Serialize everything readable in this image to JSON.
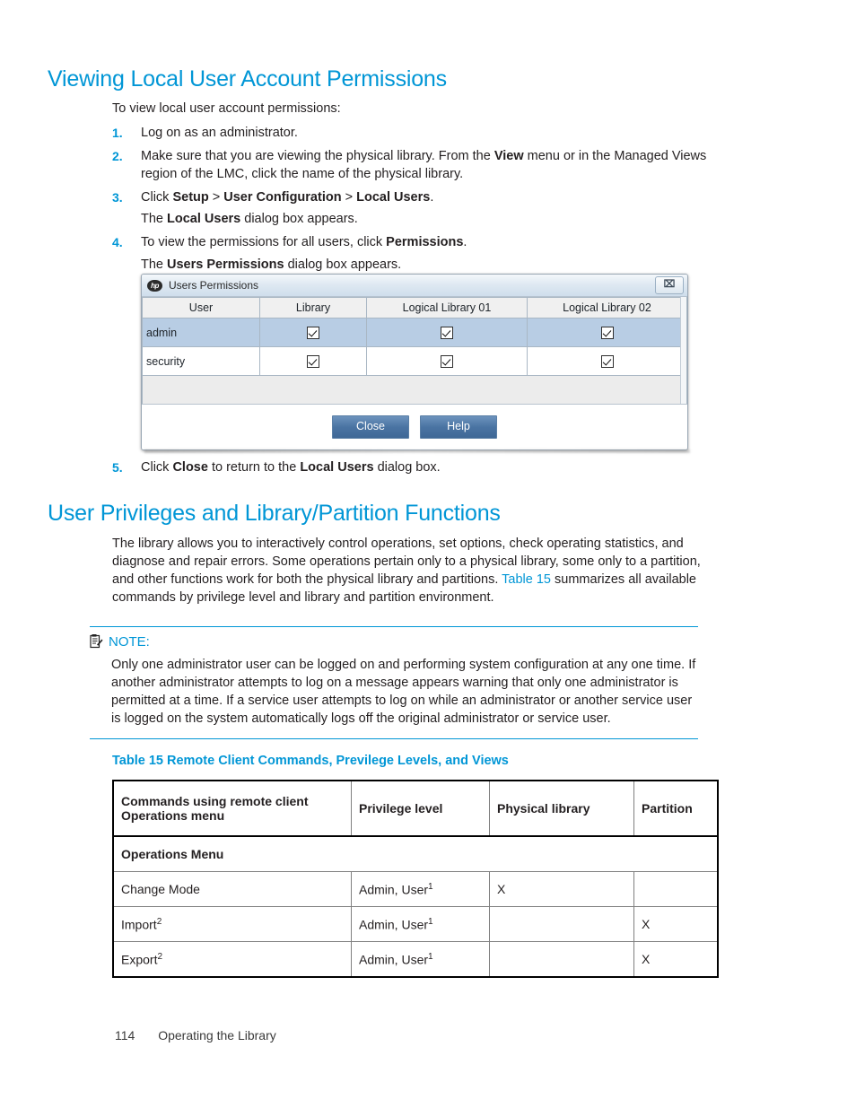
{
  "headings": {
    "viewing": "Viewing Local User Account Permissions",
    "privileges": "User Privileges and Library/Partition Functions"
  },
  "intro": "To view local user account permissions:",
  "steps": [
    {
      "num": "1.",
      "parts": [
        {
          "t": "Log on as an administrator.",
          "b": false
        }
      ]
    },
    {
      "num": "2.",
      "parts": [
        {
          "t": "Make sure that you are viewing the physical library. From the ",
          "b": false
        },
        {
          "t": "View",
          "b": true
        },
        {
          "t": " menu or in the Managed Views region of the LMC, click the name of the physical library.",
          "b": false
        }
      ]
    },
    {
      "num": "3.",
      "parts": [
        {
          "t": "Click ",
          "b": false
        },
        {
          "t": "Setup",
          "b": true
        },
        {
          "t": " > ",
          "b": false
        },
        {
          "t": "User Configuration",
          "b": true
        },
        {
          "t": " > ",
          "b": false
        },
        {
          "t": "Local Users",
          "b": true
        },
        {
          "t": ".",
          "b": false
        }
      ],
      "sub": [
        {
          "t": "The ",
          "b": false
        },
        {
          "t": "Local Users",
          "b": true
        },
        {
          "t": " dialog box appears.",
          "b": false
        }
      ]
    },
    {
      "num": "4.",
      "parts": [
        {
          "t": "To view the permissions for all users, click ",
          "b": false
        },
        {
          "t": "Permissions",
          "b": true
        },
        {
          "t": ".",
          "b": false
        }
      ],
      "sub": [
        {
          "t": "The ",
          "b": false
        },
        {
          "t": "Users Permissions",
          "b": true
        },
        {
          "t": " dialog box appears.",
          "b": false
        }
      ]
    }
  ],
  "step5": {
    "num": "5.",
    "parts": [
      {
        "t": "Click ",
        "b": false
      },
      {
        "t": "Close",
        "b": true
      },
      {
        "t": " to return to the ",
        "b": false
      },
      {
        "t": "Local Users",
        "b": true
      },
      {
        "t": " dialog box.",
        "b": false
      }
    ]
  },
  "dialog": {
    "logo": "hp",
    "title": "Users Permissions",
    "close_glyph": "⌧",
    "columns": [
      "User",
      "Library",
      "Logical Library 01",
      "Logical Library 02"
    ],
    "rows": [
      {
        "user": "admin",
        "selected": true,
        "checks": [
          true,
          true,
          true
        ]
      },
      {
        "user": "security",
        "selected": false,
        "checks": [
          true,
          true,
          true
        ]
      }
    ],
    "buttons": [
      {
        "label": "Close",
        "name": "close-button"
      },
      {
        "label": "Help",
        "name": "help-button"
      }
    ]
  },
  "paragraph": {
    "part1": "The library allows you to interactively control operations, set options, check operating statistics, and diagnose and repair errors. Some operations pertain only to a physical library, some only to a partition, and other functions work for both the physical library and partitions. ",
    "xref": "Table 15",
    "part2": " summarizes all available commands by privilege level and library and partition environment."
  },
  "note": {
    "label": "NOTE:",
    "body": "Only one administrator user can be logged on and performing system configuration at any one time. If another administrator attempts to log on a message appears warning that only one administrator is permitted at a time. If a service user attempts to log on while an administrator or another service user is logged on the system automatically logs off the original administrator or service user."
  },
  "table15": {
    "caption": "Table 15 Remote Client Commands, Previlege Levels, and Views",
    "headers": [
      "Commands using remote client Operations menu",
      "Privilege level",
      "Physical library",
      "Partition"
    ],
    "subhead": "Operations Menu",
    "rows": [
      {
        "command": "Change Mode",
        "command_sup": "",
        "privilege": "Admin, User",
        "privilege_sup": "1",
        "physical": "X",
        "partition": ""
      },
      {
        "command": "Import",
        "command_sup": "2",
        "privilege": "Admin, User",
        "privilege_sup": "1",
        "physical": "",
        "partition": "X"
      },
      {
        "command": "Export",
        "command_sup": "2",
        "privilege": "Admin, User",
        "privilege_sup": "1",
        "physical": "",
        "partition": "X"
      }
    ]
  },
  "footer": {
    "page_number": "114",
    "chapter": "Operating the Library"
  },
  "colors": {
    "heading": "#0096d6",
    "link": "#0096d6",
    "body": "#231f20",
    "selected_row": "#b8cde4",
    "button": "#4a74a3"
  }
}
